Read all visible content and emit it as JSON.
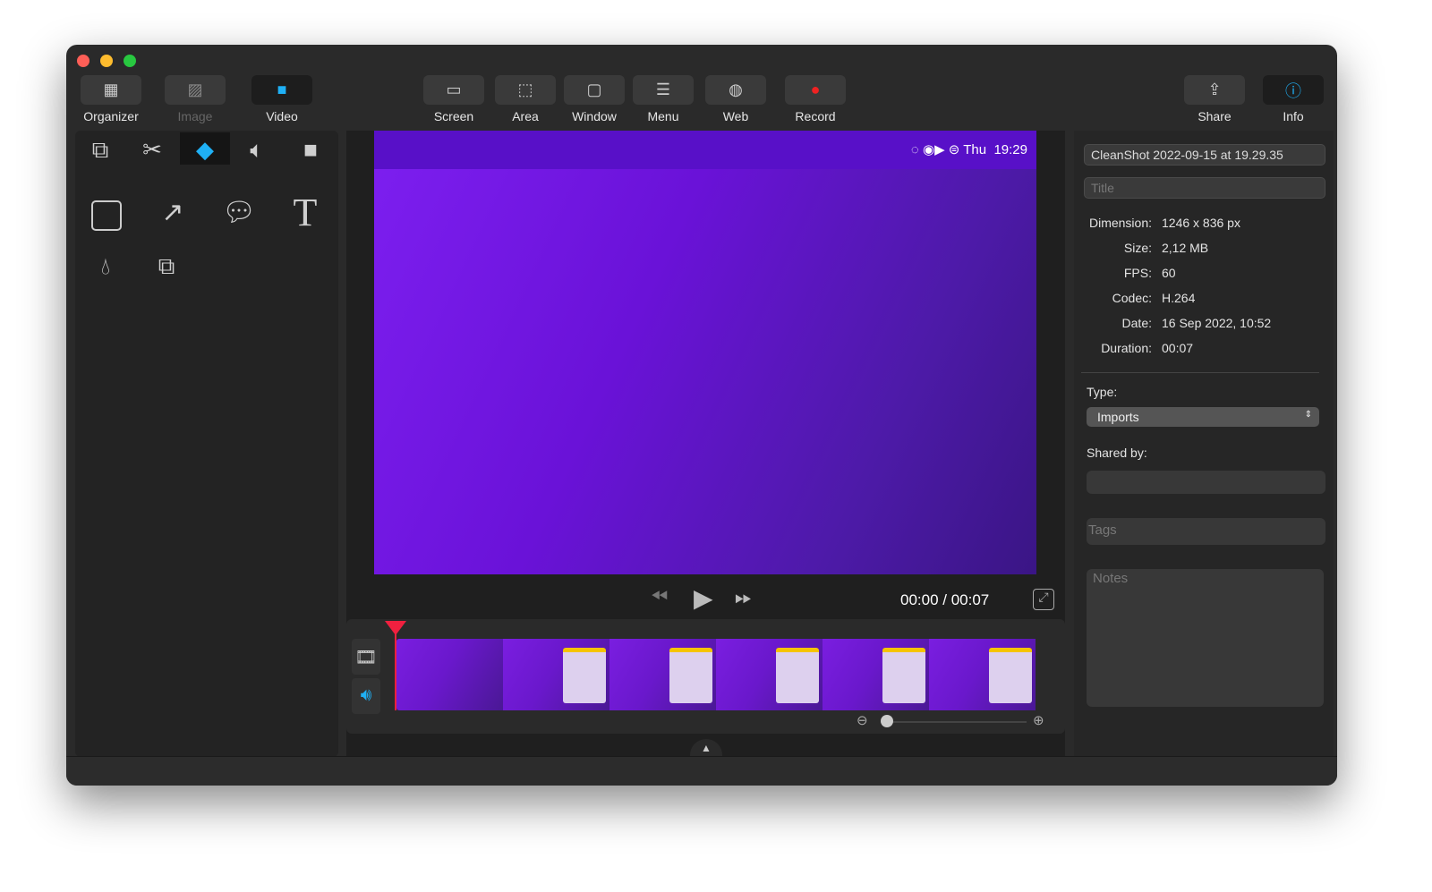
{
  "toolbar": {
    "left": [
      {
        "label": "Organizer",
        "icon": "grid-icon"
      },
      {
        "label": "Image",
        "icon": "image-icon",
        "disabled": true
      },
      {
        "label": "Video",
        "icon": "video-annotate-icon",
        "active": true
      }
    ],
    "capture": [
      {
        "label": "Screen",
        "icon": "screen-icon"
      },
      {
        "label": "Area",
        "icon": "area-icon"
      },
      {
        "label": "Window",
        "icon": "window-icon"
      },
      {
        "label": "Menu",
        "icon": "menu-icon"
      },
      {
        "label": "Web",
        "icon": "globe-icon"
      },
      {
        "label": "Record",
        "icon": "record-icon"
      }
    ],
    "right": [
      {
        "label": "Share",
        "icon": "share-icon"
      },
      {
        "label": "Info",
        "icon": "info-icon"
      }
    ]
  },
  "preview": {
    "menubar_day": "Thu",
    "menubar_time": "19:29"
  },
  "player": {
    "time": "00:00 / 00:07"
  },
  "info": {
    "name": "CleanShot 2022-09-15 at 19.29.35",
    "title_placeholder": "Title",
    "rows": [
      {
        "k": "Dimension:",
        "v": "1246 x 836 px"
      },
      {
        "k": "Size:",
        "v": "2,12 MB"
      },
      {
        "k": "FPS:",
        "v": "60"
      },
      {
        "k": "Codec:",
        "v": "H.264"
      },
      {
        "k": "Date:",
        "v": "16 Sep 2022, 10:52"
      },
      {
        "k": "Duration:",
        "v": "00:07"
      }
    ],
    "type_label": "Type:",
    "type_value": "Imports",
    "shared_label": "Shared by:",
    "tags_placeholder": "Tags",
    "notes_placeholder": "Notes"
  },
  "colors": {
    "accent": "#1fb0f5",
    "playhead": "#f0203f",
    "preview_purple": "#6a14d6"
  },
  "timeline": {
    "zoom_level": 0.0
  }
}
